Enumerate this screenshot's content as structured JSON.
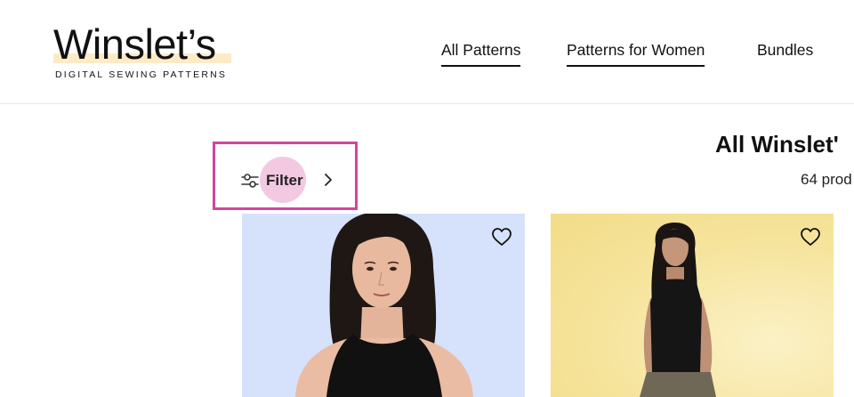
{
  "brand": {
    "name": "Winslet’s",
    "tagline": "DIGITAL SEWING PATTERNS",
    "highlight_color": "#fdebc8"
  },
  "nav": {
    "items": [
      {
        "label": "All Patterns",
        "underlined": true
      },
      {
        "label": "Patterns for Women",
        "underlined": true
      },
      {
        "label": "Bundles",
        "underlined": false
      }
    ]
  },
  "filter": {
    "label": "Filter",
    "icon": "sliders-icon",
    "chevron": "chevron-right-icon",
    "highlight_color": "#d2469a",
    "pill_color": "#f3c9e2"
  },
  "collection": {
    "title": "All Winslet'",
    "count": "64 prod"
  },
  "products": [
    {
      "background": "#d6e1fb",
      "icon": "heart-icon"
    },
    {
      "background": "#f6e49c",
      "icon": "heart-icon"
    }
  ]
}
